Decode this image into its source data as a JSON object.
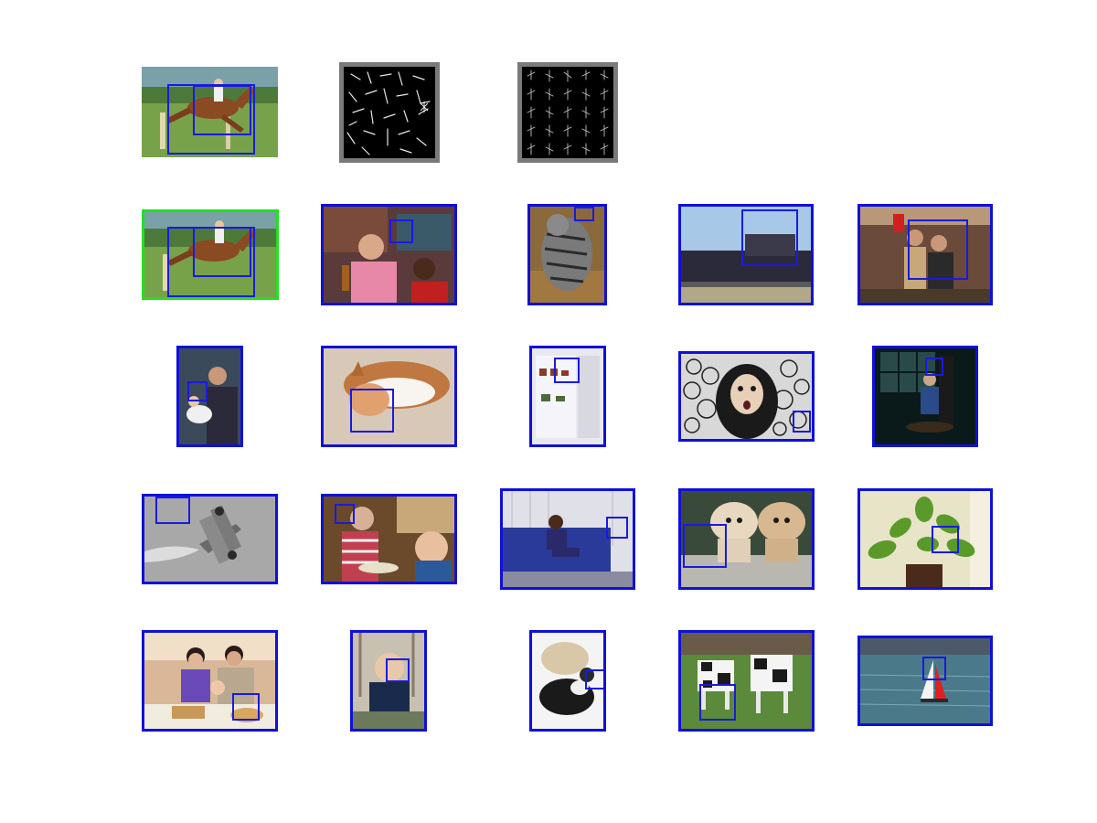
{
  "figure": {
    "rows": [
      {
        "row_id": "query-row",
        "tiles": [
          {
            "kind": "photo",
            "subject": "horse-jumping",
            "framed": false
          },
          {
            "kind": "hog-template",
            "subject": "hog-template-a"
          },
          {
            "kind": "hog-template",
            "subject": "hog-template-b"
          }
        ]
      },
      {
        "row_id": "detections-row-1",
        "tiles": [
          {
            "kind": "photo",
            "subject": "horse-jumping",
            "frame_color": "#22e022"
          },
          {
            "kind": "photo",
            "subject": "man-with-bottle",
            "frame_color": "#1010d8"
          },
          {
            "kind": "photo",
            "subject": "tabby-cat",
            "frame_color": "#1010d8"
          },
          {
            "kind": "photo",
            "subject": "locomotive",
            "frame_color": "#1010d8"
          },
          {
            "kind": "photo",
            "subject": "couple-indoors",
            "frame_color": "#1010d8"
          }
        ]
      },
      {
        "row_id": "detections-row-2",
        "tiles": [
          {
            "kind": "photo",
            "subject": "man-holding-baby",
            "frame_color": "#1010d8"
          },
          {
            "kind": "photo",
            "subject": "sleeping-cat",
            "frame_color": "#1010d8"
          },
          {
            "kind": "photo",
            "subject": "open-refrigerator",
            "frame_color": "#1010d8"
          },
          {
            "kind": "photo",
            "subject": "surprised-woman",
            "frame_color": "#1010d8"
          },
          {
            "kind": "photo",
            "subject": "seated-figurine",
            "frame_color": "#1010d8"
          }
        ]
      },
      {
        "row_id": "detections-row-3",
        "tiles": [
          {
            "kind": "photo",
            "subject": "biplane",
            "frame_color": "#1010d8"
          },
          {
            "kind": "photo",
            "subject": "woman-and-baby",
            "frame_color": "#1010d8"
          },
          {
            "kind": "photo",
            "subject": "person-on-sofa",
            "frame_color": "#1010d8"
          },
          {
            "kind": "photo",
            "subject": "two-dogs",
            "frame_color": "#1010d8"
          },
          {
            "kind": "photo",
            "subject": "potted-plant",
            "frame_color": "#1010d8"
          }
        ]
      },
      {
        "row_id": "detections-row-4",
        "tiles": [
          {
            "kind": "photo",
            "subject": "family-dinner",
            "frame_color": "#1010d8"
          },
          {
            "kind": "photo",
            "subject": "toddler",
            "frame_color": "#1010d8"
          },
          {
            "kind": "photo",
            "subject": "curled-cats",
            "frame_color": "#1010d8"
          },
          {
            "kind": "photo",
            "subject": "cows",
            "frame_color": "#1010d8"
          },
          {
            "kind": "photo",
            "subject": "sailboats",
            "frame_color": "#1010d8"
          }
        ]
      }
    ],
    "colors": {
      "detection_box": "#1a1adf",
      "query_frame": "#22e022",
      "result_frame": "#1010d8",
      "hog_background": "#7a7a7a"
    }
  }
}
